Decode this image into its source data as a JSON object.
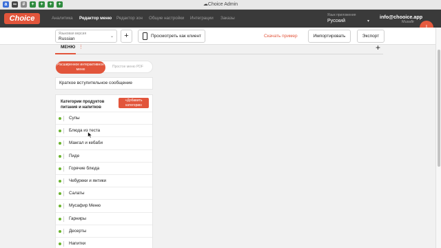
{
  "browser": {
    "title": "Choice Admin",
    "tabs": [
      {
        "icon": "a-tab-icon",
        "glyph": "a",
        "color": "#3b6fd8"
      },
      {
        "icon": "cloud-tab-icon",
        "glyph": "∞",
        "color": "#444444"
      },
      {
        "icon": "key-tab-icon",
        "glyph": "#",
        "color": "#888888"
      },
      {
        "icon": "plus-tab-icon",
        "glyph": "+",
        "color": "#2e8b3e"
      },
      {
        "icon": "plus-tab-icon",
        "glyph": "+",
        "color": "#2e8b3e"
      },
      {
        "icon": "plus-tab-icon",
        "glyph": "+",
        "color": "#2e8b3e"
      },
      {
        "icon": "plus-tab-icon",
        "glyph": "+",
        "color": "#2e8b3e"
      }
    ]
  },
  "app": {
    "logo": "Choice",
    "brand_color": "#e2553b",
    "nav": {
      "analytics": "Аналитика",
      "menu_editor": "Редактор меню",
      "zone_editor": "Редактор зон",
      "general_settings": "Общие настройки",
      "integrations": "Интеграции",
      "orders": "Заказы"
    },
    "app_language": {
      "label": "Язык приложения",
      "value": "Русский"
    },
    "account": {
      "email": "info@chooice.app",
      "name": "Musafir",
      "avatar_letter": "I"
    }
  },
  "toolbar": {
    "language_version": {
      "label": "Языковая версия",
      "value": "Russian"
    },
    "add_label": "+",
    "preview_label": "Просмотреть как клиент",
    "download_label": "Скачать пример",
    "import_label": "Импортировать",
    "export_label": "Экспорт"
  },
  "menu": {
    "tab_label": "МЕНЮ",
    "dots": "⋮",
    "add": "+",
    "toggle": {
      "active": "Расширенное интерактивное меню",
      "inactive": "Простое меню PDF"
    },
    "intro_message": "Краткое вступительное сообщение",
    "categories_title": "Категории продуктов питания и напитков",
    "add_category": "+Добавить категорию",
    "categories": [
      "Супы",
      "Блюда из теста",
      "Мангал и кебаби",
      "Пиде",
      "Горячие блюда",
      "Чебуреки и янтики",
      "Салаты",
      "Мусафир Меню",
      "Гарниры",
      "Десерты",
      "Напитки"
    ]
  }
}
